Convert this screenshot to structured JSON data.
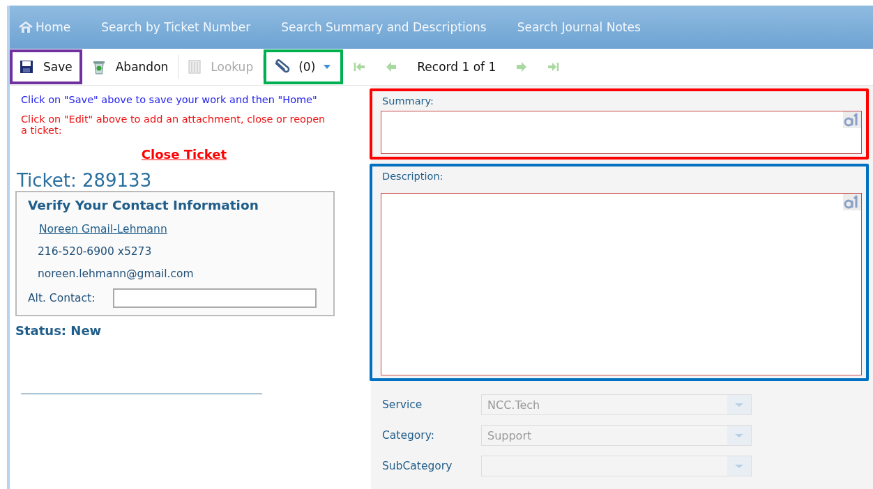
{
  "nav": [
    {
      "label": "Home",
      "kind": "home"
    },
    {
      "label": "Search by Ticket Number",
      "kind": "link"
    },
    {
      "label": "Search Summary and Descriptions",
      "kind": "link"
    },
    {
      "label": "Search Journal Notes",
      "kind": "link"
    }
  ],
  "toolbar": [
    {
      "kind": "save",
      "label": "Save",
      "disabled": false,
      "color": "#7030a0"
    },
    {
      "kind": "abandon",
      "label": "Abandon",
      "disabled": false
    },
    {
      "kind": "lookup",
      "label": "Lookup",
      "disabled": true
    },
    {
      "kind": "attach",
      "label": "(0)",
      "disabled": false,
      "color": "#00b050"
    },
    {
      "kind": "first",
      "disabled": true
    },
    {
      "kind": "prev",
      "disabled": true
    },
    {
      "kind": "record",
      "label": "Record 1 of 1"
    },
    {
      "kind": "next",
      "disabled": true
    },
    {
      "kind": "last",
      "disabled": true
    }
  ],
  "left": {
    "save_hint": "Click on \"Save\" above to save your work and then \"Home\"",
    "edit_hint": "Click on \"Edit\" above to add an attachment, close or reopen a ticket:",
    "close_link": "Close Ticket",
    "ticket_title": "Ticket: 289133",
    "contact": {
      "heading": "Verify Your Contact Information",
      "name": "Noreen Gmail-Lehmann",
      "phone": "216-520-6900 x5273",
      "email": "noreen.lehmann@gmail.com",
      "alt_label": "Alt. Contact:"
    },
    "status": "Status: New"
  },
  "right": {
    "text_fields": [
      {
        "label": "Summary:",
        "color": "#ff0000",
        "kind": "short"
      },
      {
        "label": "Description:",
        "color": "#0070c0",
        "kind": "tall"
      }
    ],
    "dropdowns": [
      {
        "label": "Service",
        "value": "NCC.Tech",
        "disabled": true
      },
      {
        "label": "Category:",
        "value": "Support",
        "disabled": true
      },
      {
        "label": "SubCategory",
        "disabled": true
      }
    ]
  }
}
